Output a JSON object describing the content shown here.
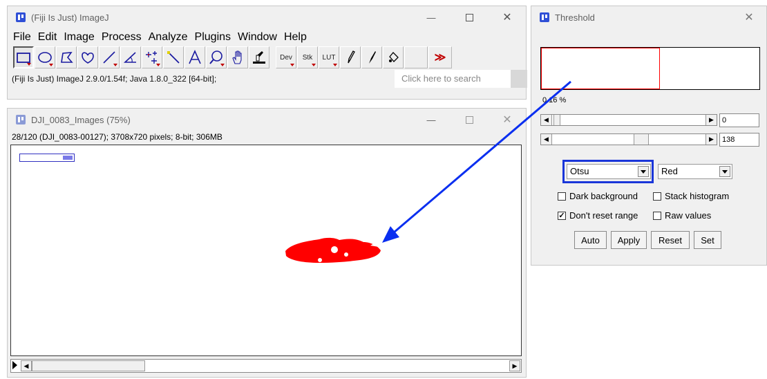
{
  "colors": {
    "accent": "#2f4fd6",
    "threshold_red": "#ff0000",
    "arrow_blue": "#0a2ff0",
    "highlight_box": "#1a36d9"
  },
  "imagej": {
    "title": "(Fiji Is Just) ImageJ",
    "menus": [
      "File",
      "Edit",
      "Image",
      "Process",
      "Analyze",
      "Plugins",
      "Window",
      "Help"
    ],
    "tools": [
      "rectangle-tool",
      "oval-tool",
      "polygon-tool",
      "freehand-tool",
      "line-tool",
      "angle-tool",
      "point-tool",
      "wand-tool",
      "text-tool",
      "magnifier-tool",
      "hand-tool",
      "dropper-tool",
      "dev-menu",
      "stk-menu",
      "lut-menu",
      "pencil-tool",
      "brush-tool",
      "flood-fill-tool",
      "more-tools"
    ],
    "tool_labels": {
      "dev": "Dev",
      "stk": "Stk",
      "lut": "LUT",
      "more": "≫"
    },
    "status": "(Fiji Is Just) ImageJ 2.9.0/1.54f; Java 1.8.0_322 [64-bit];",
    "search_placeholder": "Click here to search"
  },
  "image_window": {
    "title": "DJI_0083_Images (75%)",
    "info": "28/120 (DJI_0083-00127); 3708x720 pixels; 8-bit; 306MB"
  },
  "threshold": {
    "title": "Threshold",
    "percent": "0.16 %",
    "min_value": "0",
    "max_value": "138",
    "method": "Otsu",
    "display": "Red",
    "dark_background": {
      "label": "Dark background",
      "checked": false
    },
    "stack_histogram": {
      "label": "Stack histogram",
      "checked": false
    },
    "dont_reset_range": {
      "label": "Don't reset range",
      "checked": true
    },
    "raw_values": {
      "label": "Raw values",
      "checked": false
    },
    "buttons": {
      "auto": "Auto",
      "apply": "Apply",
      "reset": "Reset",
      "set": "Set"
    }
  }
}
